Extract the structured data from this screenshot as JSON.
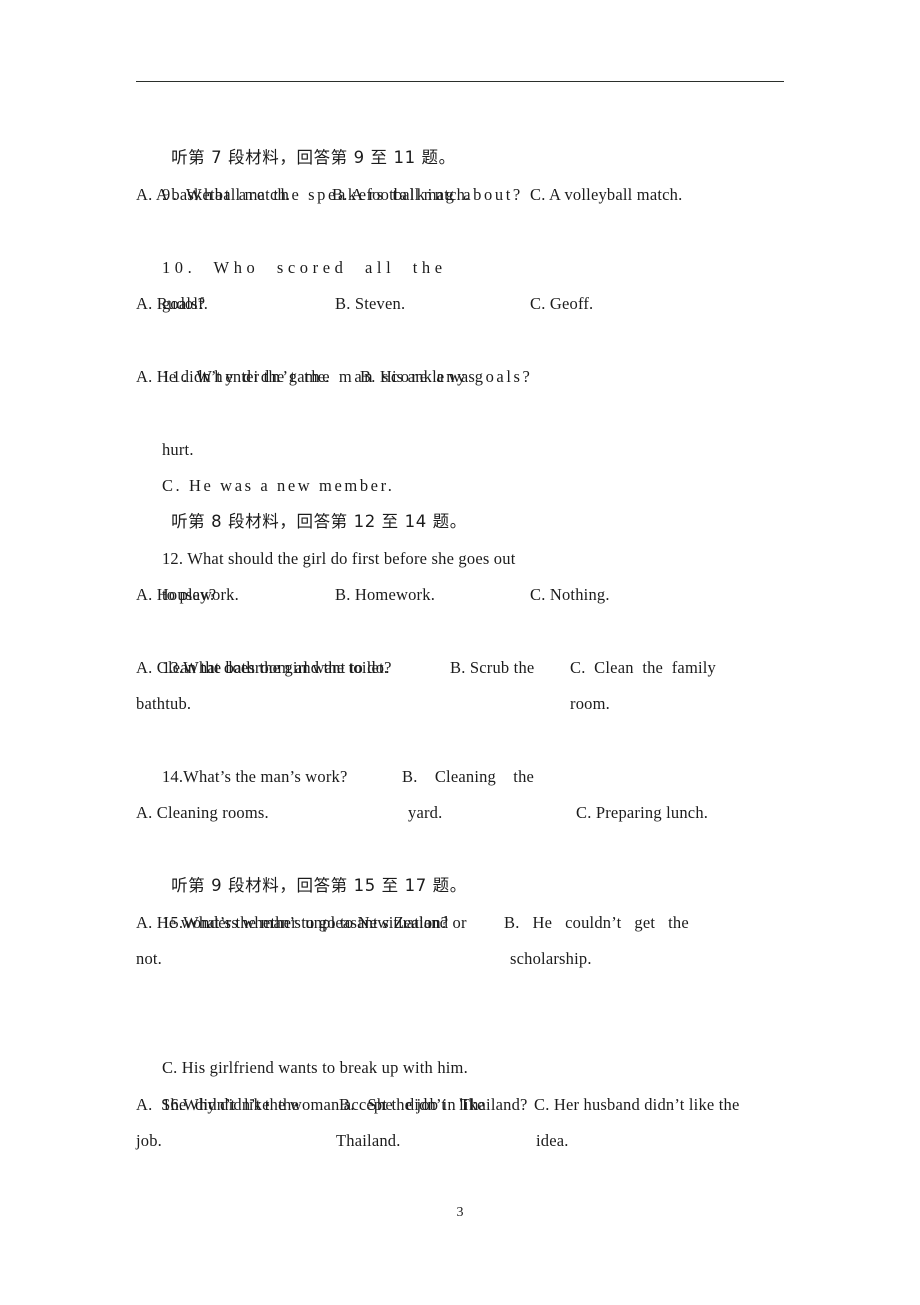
{
  "document": {
    "page_number": "3",
    "subject_hint": "English listening comprehension",
    "header_rule": true
  },
  "lines": [
    {
      "id": "l01",
      "kind": "section-heading",
      "text": "听第 7 段材料，回答第 9 至 11 题。"
    },
    {
      "id": "l02",
      "kind": "question",
      "text": "9. What are the speakers talking about?"
    },
    {
      "id": "l03",
      "kind": "options",
      "a": "A. A basketball match.",
      "b": "B. A football match.",
      "c": "C. A volleyball match."
    },
    {
      "id": "l04",
      "kind": "question",
      "text": "10.  Who  scored  all  the"
    },
    {
      "id": "l05",
      "kind": "question-cont",
      "text": "goals?"
    },
    {
      "id": "l06",
      "kind": "options",
      "a": "A. Rudolf.",
      "b": "B. Steven.",
      "c": "C. Geoff."
    },
    {
      "id": "l07",
      "kind": "question",
      "text": "11. Why didn’t the man score any goals?"
    },
    {
      "id": "l08",
      "kind": "options",
      "a": "A. He didn’t enter the game.",
      "b": "B. His ankle was",
      "c": ""
    },
    {
      "id": "l09",
      "kind": "option-cont",
      "text": "hurt."
    },
    {
      "id": "l10",
      "kind": "option",
      "text": "C. He was a new member."
    },
    {
      "id": "l11",
      "kind": "section-heading",
      "text": "听第 8 段材料，回答第 12 至 14 题。"
    },
    {
      "id": "l12",
      "kind": "question",
      "text": "12. What should the girl do first before she goes out"
    },
    {
      "id": "l13",
      "kind": "question-cont",
      "text": "to play?"
    },
    {
      "id": "l14",
      "kind": "options",
      "a": "A. Housework.",
      "b": "B. Homework.",
      "c": "C. Nothing."
    },
    {
      "id": "l15",
      "kind": "question",
      "text": "13.What does the girl want to do?"
    },
    {
      "id": "l16",
      "kind": "options",
      "a": "A. Clean the bathroom and the toilet.",
      "b": "B. Scrub the",
      "c": "C.  Clean  the  family"
    },
    {
      "id": "l17",
      "kind": "options-cont",
      "a": "bathtub.",
      "b": "",
      "c": "room."
    },
    {
      "id": "l18",
      "kind": "question",
      "text": "14.What’s the man’s work?"
    },
    {
      "id": "l19",
      "kind": "option-stray",
      "text": "B.    Cleaning    the"
    },
    {
      "id": "l20",
      "kind": "options",
      "a": "A. Cleaning rooms.",
      "b": "yard.",
      "c": "C. Preparing lunch."
    },
    {
      "id": "l21",
      "kind": "section-heading",
      "text": "听第 9 段材料，回答第 15 至 17 题。"
    },
    {
      "id": "l22",
      "kind": "question",
      "text": "15.What’s the man’s unpleasant situation?"
    },
    {
      "id": "l23",
      "kind": "options",
      "a": "A. He wonders whether to go to New Zealand or",
      "b": "B.   He   couldn’t   get   the",
      "c": ""
    },
    {
      "id": "l24",
      "kind": "options-cont",
      "a": "not.",
      "b": "scholarship.",
      "c": ""
    },
    {
      "id": "l25",
      "kind": "blank",
      "text": ""
    },
    {
      "id": "l26",
      "kind": "option",
      "text": "C. His girlfriend wants to break up with him."
    },
    {
      "id": "l27",
      "kind": "question",
      "text": "16.Why didn’t the woman accept the job in Thailand?"
    },
    {
      "id": "l28",
      "kind": "options",
      "a": "A.  She  didn’t  like  the",
      "b": "B.   She   didn’t   like",
      "c": "C. Her husband didn’t like the"
    },
    {
      "id": "l29",
      "kind": "options-cont",
      "a": "job.",
      "b": "Thailand.",
      "c": "idea."
    }
  ]
}
